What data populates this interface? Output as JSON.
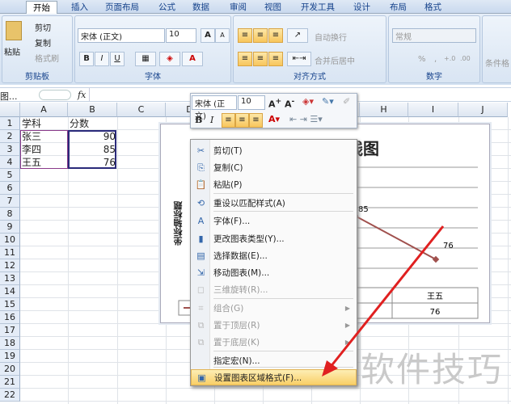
{
  "ribbon": {
    "tabs": [
      "开始",
      "插入",
      "页面布局",
      "公式",
      "数据",
      "审阅",
      "视图",
      "开发工具",
      "设计",
      "布局",
      "格式"
    ],
    "clipboard": {
      "paste": "粘贴",
      "cut": "剪切",
      "copy": "复制",
      "format_painter": "格式刷",
      "label": "剪贴板"
    },
    "font": {
      "name": "宋体 (正文)",
      "size": "10",
      "bold": "B",
      "italic": "I",
      "underline": "U",
      "grow": "A",
      "shrink": "A",
      "label": "字体"
    },
    "alignment": {
      "wrap": "自动换行",
      "merge": "合并后居中",
      "label": "对齐方式"
    },
    "number": {
      "format": "常规",
      "percent": "%",
      "comma": ",",
      "inc": "+.0",
      "dec": ".00",
      "label": "数字"
    },
    "styles": {
      "conditional": "条件格"
    }
  },
  "formula_bar": {
    "name_box": "图...",
    "fx": "fx",
    "value": ""
  },
  "sheet": {
    "columns": [
      "A",
      "B",
      "C",
      "D",
      "E",
      "F",
      "G",
      "H",
      "I",
      "J"
    ],
    "rows": [
      "1",
      "2",
      "3",
      "4",
      "5",
      "6",
      "7",
      "8",
      "9",
      "10",
      "11",
      "12",
      "13",
      "14",
      "15",
      "16",
      "17",
      "18",
      "19",
      "20",
      "21",
      "22"
    ],
    "cells": [
      [
        "学科",
        "分数"
      ],
      [
        "张三",
        "90"
      ],
      [
        "李四",
        "85"
      ],
      [
        "王五",
        "76"
      ]
    ]
  },
  "chart": {
    "title": "班级分数折线图",
    "y_axis_title": "坐标轴标题",
    "data_labels": [
      "85",
      "76"
    ],
    "table_header": "王五",
    "table_value": "76"
  },
  "chart_data": {
    "type": "line",
    "categories": [
      "张三",
      "李四",
      "王五"
    ],
    "values": [
      90,
      85,
      76
    ]
  },
  "mini_toolbar": {
    "font": "宋体 (正文)",
    "size": "10",
    "bold": "B",
    "italic": "I"
  },
  "context_menu": [
    {
      "label": "剪切(T)",
      "icon": "scissors-icon",
      "enabled": true
    },
    {
      "label": "复制(C)",
      "icon": "copy-icon",
      "enabled": true
    },
    {
      "label": "粘贴(P)",
      "icon": "paste-icon",
      "enabled": true
    },
    {
      "label": "重设以匹配样式(A)",
      "icon": "reset-style-icon",
      "enabled": true
    },
    {
      "label": "字体(F)...",
      "icon": "font-icon",
      "enabled": true
    },
    {
      "label": "更改图表类型(Y)...",
      "icon": "chart-type-icon",
      "enabled": true
    },
    {
      "label": "选择数据(E)...",
      "icon": "select-data-icon",
      "enabled": true
    },
    {
      "label": "移动图表(M)...",
      "icon": "move-chart-icon",
      "enabled": true
    },
    {
      "label": "三维旋转(R)...",
      "icon": "rotate-3d-icon",
      "enabled": false
    },
    {
      "label": "组合(G)",
      "icon": "group-icon",
      "enabled": false
    },
    {
      "label": "置于顶层(R)",
      "icon": "bring-front-icon",
      "enabled": false
    },
    {
      "label": "置于底层(K)",
      "icon": "send-back-icon",
      "enabled": false
    },
    {
      "label": "指定宏(N)...",
      "icon": "macro-icon",
      "enabled": true
    },
    {
      "label": "设置图表区域格式(F)...",
      "icon": "format-chart-area-icon",
      "enabled": true
    }
  ],
  "watermark": "软件技巧",
  "colors": {
    "accent": "#f9cf67",
    "line": "#a0504d",
    "arrow": "#e02020"
  }
}
